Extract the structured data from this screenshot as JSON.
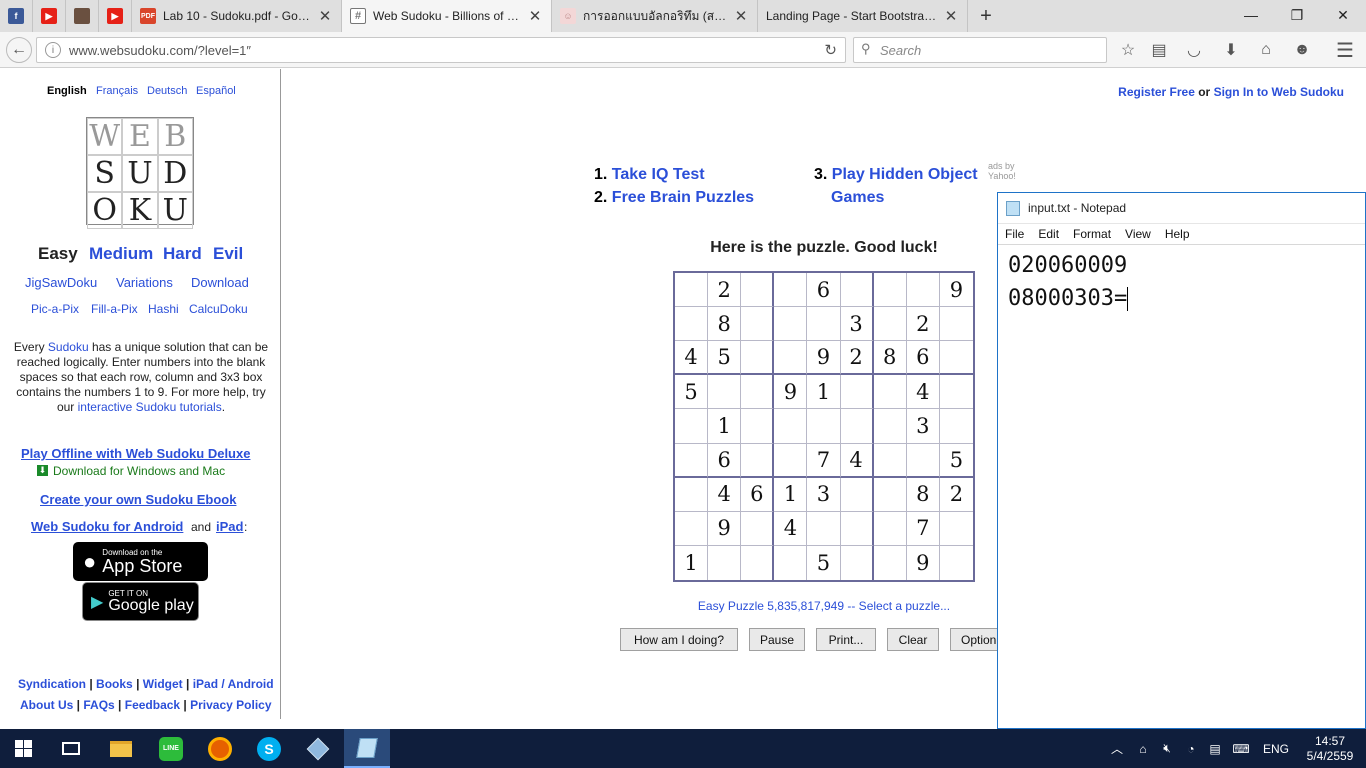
{
  "browser": {
    "tabs": [
      {
        "label": "Lab 10 - Sudoku.pdf - Goo...",
        "icon": "pdf-icon",
        "active": false
      },
      {
        "label": "Web Sudoku - Billions of F...",
        "icon": "grid-icon",
        "active": true
      },
      {
        "label": "การออกแบบอัลกอริทึม (สม...",
        "icon": "person-icon",
        "active": false
      },
      {
        "label": "Landing Page - Start Bootstrap...",
        "icon": "blank-icon",
        "active": false
      }
    ],
    "url": "www.websudoku.com/?level=1″",
    "search_placeholder": "Search"
  },
  "site": {
    "languages": {
      "current": "English",
      "others": [
        "Français",
        "Deutsch",
        "Español"
      ]
    },
    "logo_letters": [
      "W",
      "E",
      "B",
      "S",
      "U",
      "D",
      "O",
      "K",
      "U"
    ],
    "levels": {
      "current": "Easy",
      "links": [
        "Medium",
        "Hard",
        "Evil"
      ]
    },
    "nav_row2": [
      "JigSawDoku",
      "Variations",
      "Download"
    ],
    "nav_row3": [
      "Pic-a-Pix",
      "Fill-a-Pix",
      "Hashi",
      "CalcuDoku"
    ],
    "blurb": {
      "p1": "Every ",
      "l1": "Sudoku",
      "p2": " has a unique solution that can be reached logically. Enter numbers into the blank spaces so that each row, column and 3x3 box contains the numbers 1 to 9. For more help, try our ",
      "l2": "interactive Sudoku tutorials",
      "p3": "."
    },
    "offline_link": "Play Offline with Web Sudoku Deluxe",
    "download_text": "Download for Windows and Mac",
    "ebook_link": "Create your own Sudoku Ebook",
    "android_link": "Web Sudoku for Android",
    "and_text": "and",
    "ipad_link": "iPad",
    "colon": ":",
    "appstore_small": "Download on the",
    "appstore_big": "App Store",
    "googleplay_small": "GET IT ON",
    "googleplay_big": "Google play",
    "footer_row1": [
      "Syndication",
      "Books",
      "Widget",
      "iPad / Android"
    ],
    "footer_row2": [
      "About Us",
      "FAQs",
      "Feedback",
      "Privacy Policy"
    ],
    "account": {
      "register": "Register Free",
      "or": "or",
      "signin": "Sign In to Web Sudoku"
    },
    "ads": {
      "items": [
        {
          "num": "1.",
          "label": "Take IQ Test"
        },
        {
          "num": "2.",
          "label": "Free Brain Puzzles"
        },
        {
          "num": "3.",
          "label": "Play Hidden Object"
        },
        {
          "num": "",
          "label": "Games"
        }
      ],
      "credit": "ads by Yahoo!"
    },
    "puzzle_title": "Here is the puzzle. Good luck!",
    "puzzle_caption": "Easy Puzzle 5,835,817,949 -- Select a puzzle...",
    "grid": [
      "",
      "2",
      "",
      "",
      "6",
      "",
      "",
      "",
      "9",
      "",
      "8",
      "",
      "",
      "",
      "3",
      "",
      "2",
      "",
      "4",
      "5",
      "",
      "",
      "9",
      "2",
      "8",
      "6",
      "",
      "5",
      "",
      "",
      "9",
      "1",
      "",
      "",
      "4",
      "",
      "",
      "1",
      "",
      "",
      "",
      "",
      "",
      "3",
      "",
      "",
      "6",
      "",
      "",
      "7",
      "4",
      "",
      "",
      "5",
      "",
      "4",
      "6",
      "1",
      "3",
      "",
      "",
      "8",
      "2",
      "",
      "9",
      "",
      "4",
      "",
      "",
      "",
      "7",
      "",
      "1",
      "",
      "",
      "",
      "5",
      "",
      "",
      "9",
      ""
    ],
    "buttons": [
      "How am I doing?",
      "Pause",
      "Print...",
      "Clear",
      "Option"
    ]
  },
  "notepad": {
    "title": "input.txt - Notepad",
    "menu": [
      "File",
      "Edit",
      "Format",
      "View",
      "Help"
    ],
    "lines": [
      "020060009",
      "08000303="
    ]
  },
  "taskbar": {
    "lang": "ENG",
    "time": "14:57",
    "date": "5/4/2559"
  }
}
